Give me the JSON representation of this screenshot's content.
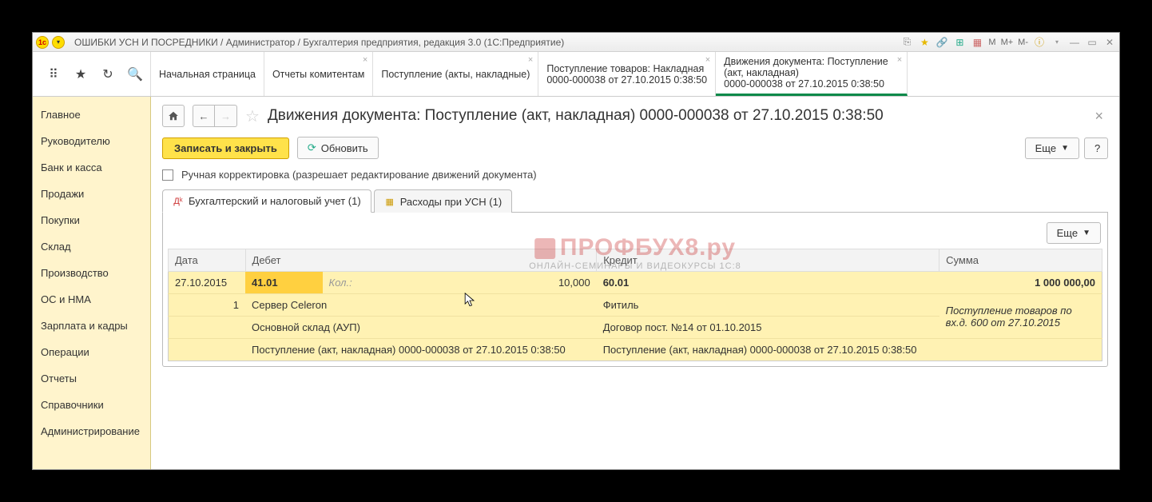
{
  "titlebar": {
    "title": "ОШИБКИ УСН И ПОСРЕДНИКИ / Администратор / Бухгалтерия предприятия, редакция 3.0  (1С:Предприятие)",
    "m1": "М",
    "m2": "М+",
    "m3": "М-"
  },
  "tabs": [
    {
      "label": "Начальная страница",
      "closable": false
    },
    {
      "label": "Отчеты комитентам",
      "closable": true
    },
    {
      "label": "Поступление (акты, накладные)",
      "closable": true
    },
    {
      "label": "Поступление товаров: Накладная",
      "label2": "0000-000038 от 27.10.2015 0:38:50",
      "closable": true
    },
    {
      "label": "Движения документа: Поступление (акт, накладная)",
      "label2": "0000-000038 от 27.10.2015 0:38:50",
      "closable": true,
      "active": true
    }
  ],
  "sidebar": {
    "items": [
      "Главное",
      "Руководителю",
      "Банк и касса",
      "Продажи",
      "Покупки",
      "Склад",
      "Производство",
      "ОС и НМА",
      "Зарплата и кадры",
      "Операции",
      "Отчеты",
      "Справочники",
      "Администрирование"
    ]
  },
  "page": {
    "title": "Движения документа: Поступление (акт, накладная) 0000-000038 от 27.10.2015 0:38:50",
    "save_close": "Записать и закрыть",
    "refresh": "Обновить",
    "more": "Еще",
    "help": "?",
    "manual_edit": "Ручная корректировка (разрешает редактирование движений документа)"
  },
  "inner_tabs": [
    {
      "label": "Бухгалтерский и налоговый учет (1)",
      "active": true
    },
    {
      "label": "Расходы при УСН (1)"
    }
  ],
  "table_toolbar": {
    "more": "Еще"
  },
  "table": {
    "headers": {
      "date": "Дата",
      "debit": "Дебет",
      "credit": "Кредит",
      "sum": "Сумма"
    },
    "qty_label": "Кол.:",
    "rows": {
      "r1": {
        "date": "27.10.2015",
        "debit_acc": "41.01",
        "debit_qty": "10,000",
        "credit_acc": "60.01",
        "sum": "1 000 000,00"
      },
      "r2": {
        "num": "1",
        "debit_desc": "Сервер Celeron",
        "credit_desc": "Фитиль",
        "sum_desc": "Поступление товаров по вх.д. 600 от 27.10.2015"
      },
      "r3": {
        "debit_desc": "Основной склад (АУП)",
        "credit_desc": "Договор пост. №14 от 01.10.2015"
      },
      "r4": {
        "debit_desc": "Поступление (акт, накладная) 0000-000038 от 27.10.2015 0:38:50",
        "credit_desc": "Поступление (акт, накладная) 0000-000038 от 27.10.2015 0:38:50"
      }
    }
  },
  "watermark": {
    "big": "ПРОФБУХ8.ру",
    "small": "ОНЛАЙН-СЕМИНАРЫ И ВИДЕОКУРСЫ 1С:8"
  }
}
